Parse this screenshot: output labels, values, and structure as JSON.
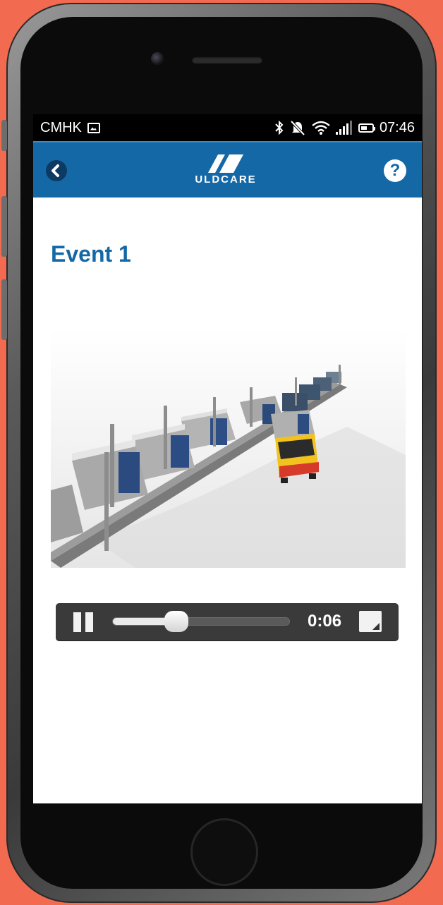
{
  "status_bar": {
    "carrier": "CMHK",
    "time": "07:46",
    "icons": [
      "image-icon",
      "bluetooth-icon",
      "muted-bell-icon",
      "wifi-icon",
      "signal-icon",
      "battery-icon"
    ]
  },
  "app_bar": {
    "logo_text": "ULDCARE",
    "back_icon": "chevron-left-icon",
    "help_label": "?",
    "color": "#1468a6"
  },
  "page": {
    "title": "Event 1"
  },
  "video": {
    "thumbnail": "airport-dolly-train-rendering",
    "time": "0:06",
    "progress": 0.36,
    "state": "playing"
  },
  "colors": {
    "background": "#f26a4f",
    "brand": "#1468a6",
    "controls": "#3a3a3a"
  }
}
